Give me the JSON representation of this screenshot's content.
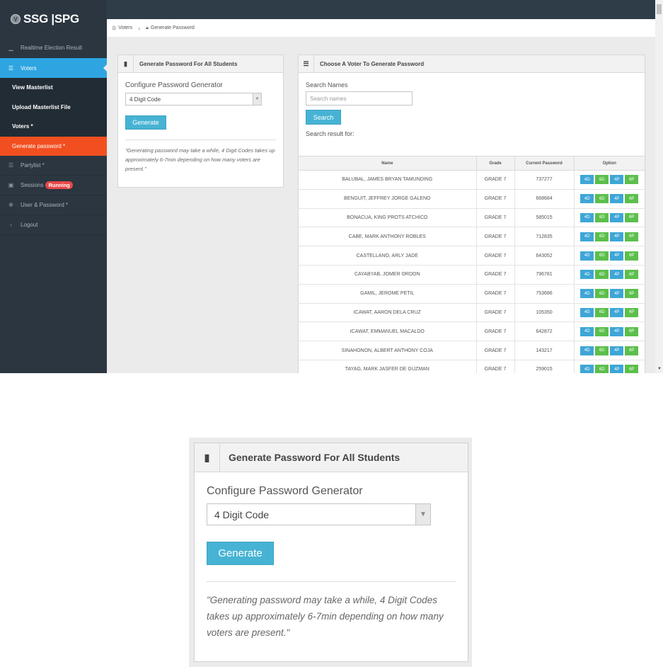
{
  "brand": {
    "badge": "V",
    "name": "SSG |SPG"
  },
  "sidebar": {
    "items": [
      {
        "label": "Realtime Election Result",
        "icon": "signal-icon"
      },
      {
        "label": "Voters",
        "icon": "list-icon"
      }
    ],
    "voters_sub": [
      {
        "label": "View Masterlist"
      },
      {
        "label": "Upload Masterlist File"
      },
      {
        "label": "Voters *"
      },
      {
        "label": "Generate password *"
      }
    ],
    "items_after": [
      {
        "label": "Partylist *",
        "icon": "list-icon"
      },
      {
        "label": "Sessions",
        "icon": "lock-icon",
        "badge": "Running"
      },
      {
        "label": "User & Password *",
        "icon": "gear-icon"
      },
      {
        "label": "Logout",
        "icon": "chevron-left-icon"
      }
    ]
  },
  "breadcrumb": {
    "first": "Voters",
    "second": "Generate Password"
  },
  "generate_panel": {
    "title": "Generate Password For All Students",
    "config_label": "Configure Password Generator",
    "select_value": "4 Digit Code",
    "generate_label": "Generate",
    "note": "\"Generating password may take a while, 4 Digit Codes takes up approximately 6-7min depending on how many voters are present.\""
  },
  "voter_panel": {
    "title": "Choose A Voter To Generate Password",
    "search_label": "Search Names",
    "search_placeholder": "Search names",
    "search_button": "Search",
    "result_label": "Search result for:",
    "columns": [
      "Name",
      "Grade",
      "Current Password",
      "Option"
    ],
    "option_buttons": [
      "4D",
      "6D",
      "4P",
      "6P"
    ],
    "rows": [
      {
        "name": "BALUBAL, JAMES BRYAN TAMUNDING",
        "grade": "GRADE 7",
        "password": "737277"
      },
      {
        "name": "BENGUIT, JEFFREY JORGE GALENO",
        "grade": "GRADE 7",
        "password": "668684"
      },
      {
        "name": "BONACUA, KING PROTS ATCHICO",
        "grade": "GRADE 7",
        "password": "585015"
      },
      {
        "name": "CABE, MARK ANTHONY ROBLES",
        "grade": "GRADE 7",
        "password": "712835"
      },
      {
        "name": "CASTELLANO, ARLY JADE",
        "grade": "GRADE 7",
        "password": "643052"
      },
      {
        "name": "CAYABYAB, JOMER ORDON",
        "grade": "GRADE 7",
        "password": "796781"
      },
      {
        "name": "GAMIL, JEROME PETIL",
        "grade": "GRADE 7",
        "password": "753686"
      },
      {
        "name": "ICAWAT, AARON DELA CRUZ",
        "grade": "GRADE 7",
        "password": "105350"
      },
      {
        "name": "ICAWAT, EMMANUEL MACALDO",
        "grade": "GRADE 7",
        "password": "642872"
      },
      {
        "name": "SINAHONON, ALBERT ANTHONY COJA",
        "grade": "GRADE 7",
        "password": "143217"
      },
      {
        "name": "TAYAG, MARK JASFER DE GUZMAN",
        "grade": "GRADE 7",
        "password": "259015"
      }
    ]
  },
  "colors": {
    "sidebar": "#2b3640",
    "active": "#2ea5e1",
    "current": "#f24f21",
    "blue_btn": "#3ea6d6",
    "green_btn": "#5cbf4c",
    "running": "#e74848"
  }
}
